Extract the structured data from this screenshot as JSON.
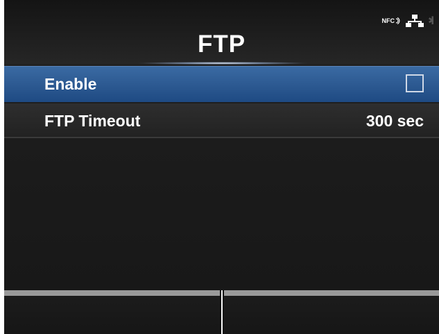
{
  "header": {
    "title": "FTP",
    "status": {
      "nfc_label": "NFC",
      "nfc_icon": "nfc-icon",
      "network_icon": "network-icon",
      "bluetooth_icon": "bluetooth-icon"
    }
  },
  "menu": {
    "items": [
      {
        "label": "Enable",
        "type": "checkbox",
        "checked": false,
        "selected": true
      },
      {
        "label": "FTP Timeout",
        "value": "300 sec",
        "selected": false
      }
    ]
  },
  "softkeys": {
    "left_label": "",
    "right_label": ""
  },
  "colors": {
    "selected_row": "#2d5a92",
    "background": "#1c1c1c",
    "text": "#ffffff",
    "softkey_bar": "#9a9a9a"
  }
}
